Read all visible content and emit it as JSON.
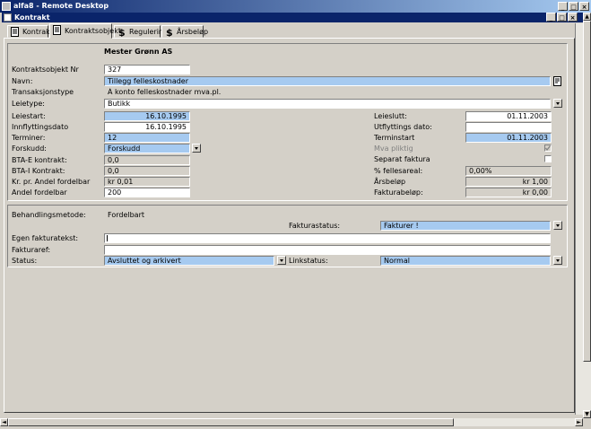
{
  "window": {
    "outer_title": "alfa8 - Remote Desktop",
    "inner_title": "Kontrakt"
  },
  "tabs": [
    {
      "label": "Kontrakt"
    },
    {
      "label": "Kontraktsobjekt"
    },
    {
      "label": "Regulering"
    },
    {
      "label": "Årsbeløp"
    }
  ],
  "header_name": "Mester Grønn AS",
  "form": {
    "objekt_nr": {
      "label": "Kontraktsobjekt Nr",
      "value": "327"
    },
    "navn": {
      "label": "Navn:",
      "value": "Tillegg felleskostnader"
    },
    "transaksjonstype": {
      "label": "Transaksjonstype",
      "value": "Á konto felleskostnader mva.pl."
    },
    "leietype": {
      "label": "Leietype:",
      "value": "Butikk"
    },
    "leiestart": {
      "label": "Leiestart:",
      "value": "16.10.1995"
    },
    "innflytting": {
      "label": "Innflyttingsdato",
      "value": "16.10.1995"
    },
    "terminer": {
      "label": "Terminer:",
      "value": "12"
    },
    "forskudd": {
      "label": "Forskudd:",
      "value": "Forskudd"
    },
    "bta_e": {
      "label": "BTA-E kontrakt:",
      "value": "0,0"
    },
    "bta_i": {
      "label": "BTA-I Kontrakt:",
      "value": "0,0"
    },
    "kr_andel": {
      "label": "Kr. pr. Andel fordelbar",
      "value": "kr 0,01"
    },
    "andel": {
      "label": "Andel fordelbar",
      "value": "200"
    },
    "leieslutt": {
      "label": "Leieslutt:",
      "value": "01.11.2003"
    },
    "utflytting": {
      "label": "Utflyttings dato:",
      "value": ""
    },
    "terminstart": {
      "label": "Terminstart",
      "value": "01.11.2003"
    },
    "mva_pliktig": {
      "label": "Mva pliktig"
    },
    "separat_faktura": {
      "label": "Separat faktura"
    },
    "fellesareal": {
      "label": "% fellesareal:",
      "value": "0,00%"
    },
    "arsbelop": {
      "label": "Årsbeløp",
      "value": "kr 1,00"
    },
    "fakturabelop": {
      "label": "Fakturabeløp:",
      "value": "kr 0,00"
    }
  },
  "billing": {
    "behandling": {
      "label": "Behandlingsmetode:",
      "value": "Fordelbart"
    },
    "fakturastatus": {
      "label": "Fakturastatus:",
      "value": "Fakturer !"
    },
    "egen_tekst": {
      "label": "Egen fakturatekst:",
      "value": ""
    },
    "fakturaref": {
      "label": "Fakturaref:",
      "value": ""
    },
    "status": {
      "label": "Status:",
      "value": "Avsluttet og arkivert"
    },
    "linkstatus": {
      "label": "Linkstatus:",
      "value": "Normal"
    }
  },
  "controls": {
    "minimize": "_",
    "restore": "□",
    "close": "×",
    "scroll_left": "◄",
    "scroll_right": "►",
    "scroll_up": "▲",
    "scroll_down": "▼"
  }
}
